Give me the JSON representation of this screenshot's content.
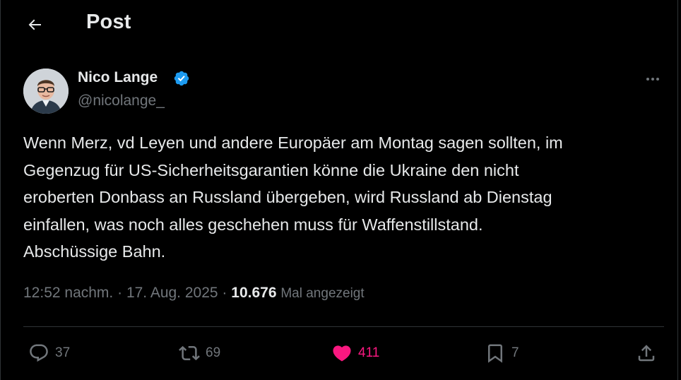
{
  "header": {
    "title": "Post"
  },
  "author": {
    "name": "Nico Lange",
    "handle": "@nicolange_",
    "verified": true
  },
  "tweet": {
    "text": "Wenn Merz, vd Leyen und andere Europäer am Montag sagen sollten, im\nGegenzug für US-Sicherheitsgarantien könne die Ukraine den nicht\neroberten Donbass an Russland übergeben, wird Russland ab Dienstag\neinfallen, was noch alles geschehen muss für Waffenstillstand.\nAbschüssige Bahn."
  },
  "meta": {
    "time": "12:52 nachm.",
    "separator": "·",
    "date": "17. Aug. 2025",
    "views_count": "10.676",
    "views_label": "Mal angezeigt"
  },
  "actions": {
    "replies": "37",
    "reposts": "69",
    "likes": "411",
    "bookmarks": "7"
  },
  "colors": {
    "background": "#000000",
    "text": "#e7e9ea",
    "muted": "#71767b",
    "like_active": "#f91880",
    "verified": "#1d9bf0",
    "divider": "#2f3336"
  },
  "icons": {
    "back": "arrow-left-icon",
    "verified": "verified-badge-icon",
    "more": "more-horizontal-icon",
    "reply": "reply-icon",
    "repost": "repost-icon",
    "like": "heart-icon",
    "bookmark": "bookmark-icon",
    "share": "share-icon"
  }
}
